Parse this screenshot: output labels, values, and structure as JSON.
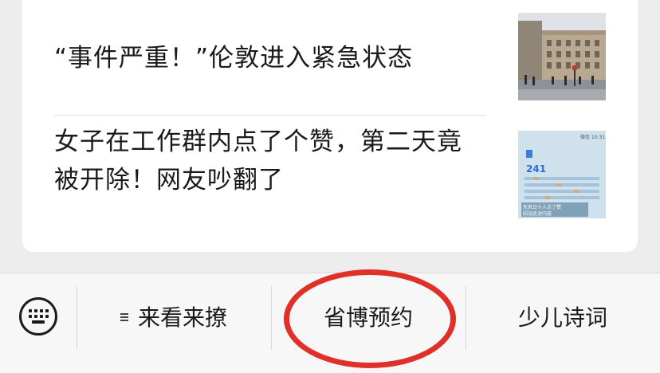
{
  "articles": [
    {
      "title": "“事件严重！”伦敦进入紧急状态",
      "thumbnail": "london-street-photo"
    },
    {
      "title": "女子在工作群内点了个赞，第二天竟被开除！网友吵翻了",
      "thumbnail": "chat-screenshot-photo",
      "thumb_text": {
        "status": "微信 10:31",
        "count": "241",
        "caption_1": "东风日十人点了赞",
        "caption_2": "因没此对内容"
      }
    }
  ],
  "menu": {
    "keyboard_icon": "keyboard-icon",
    "items": [
      {
        "label": "来看来撩",
        "icon": "menu-list-icon"
      },
      {
        "label": "省博预约"
      },
      {
        "label": "少儿诗词"
      }
    ]
  },
  "annotation_color": "#e0302a"
}
